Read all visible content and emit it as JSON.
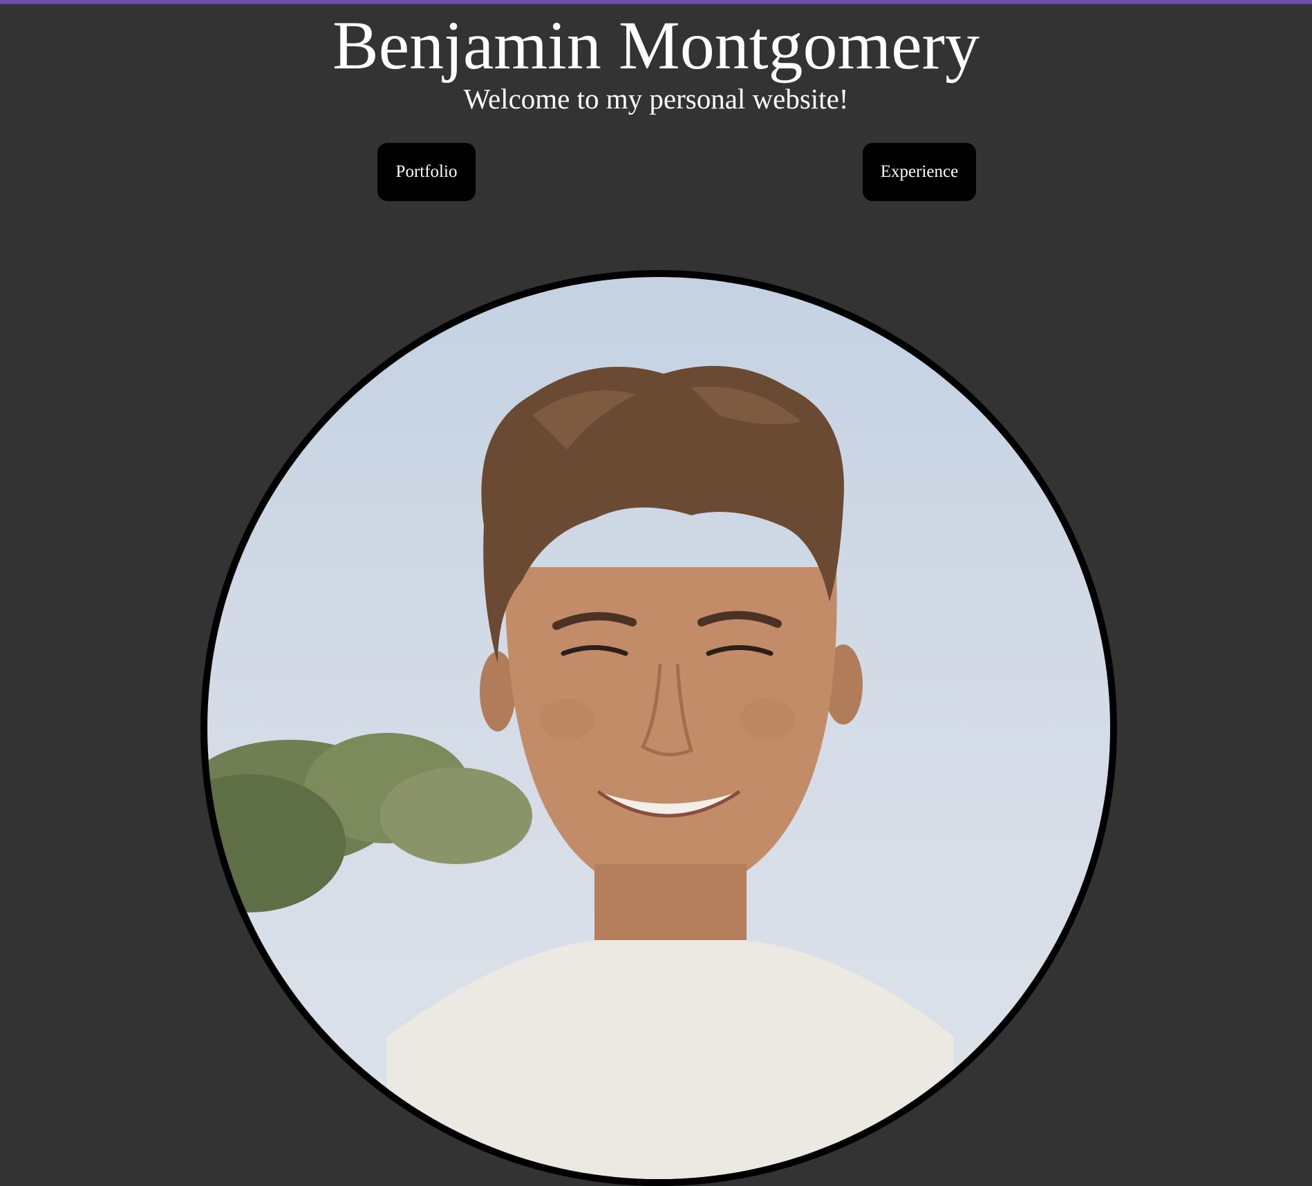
{
  "header": {
    "title": "Benjamin Montgomery",
    "subtitle": "Welcome to my personal website!"
  },
  "nav": {
    "portfolio_label": "Portfolio",
    "experience_label": "Experience"
  },
  "colors": {
    "background": "#333333",
    "accent_bar": "#6a4fa8",
    "button_bg": "#000000",
    "text": "#ffffff"
  },
  "photo": {
    "subject": "profile-portrait"
  }
}
